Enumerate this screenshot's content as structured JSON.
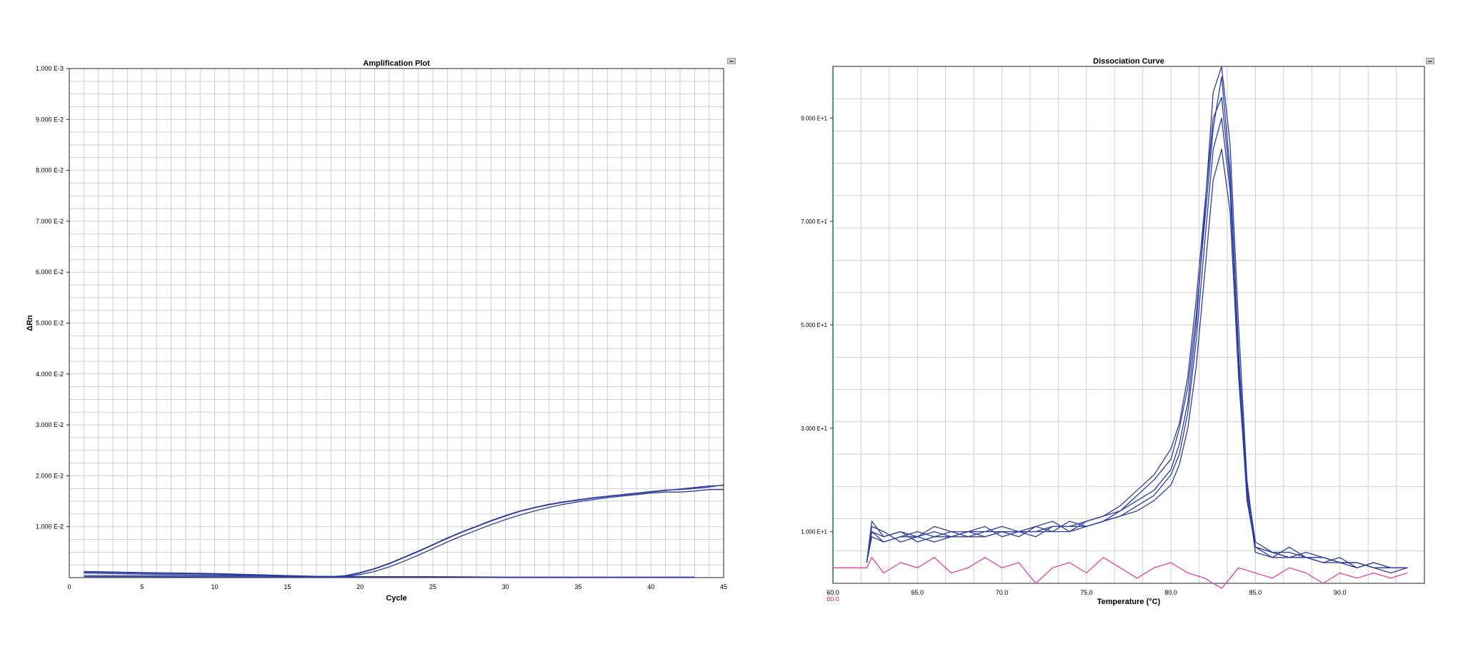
{
  "chart_data": [
    {
      "type": "line",
      "title": "Amplification Plot",
      "xlabel": "Cycle",
      "ylabel": "ΔRn",
      "xlim": [
        0,
        45
      ],
      "ylim": [
        0,
        0.1
      ],
      "x_ticks": [
        0,
        5,
        10,
        15,
        20,
        25,
        30,
        35,
        40,
        45
      ],
      "y_ticks": [
        0.01,
        0.02,
        0.03,
        0.04,
        0.05,
        0.06,
        0.07,
        0.08,
        0.09,
        0.1
      ],
      "y_tick_labels": [
        "1.000 E-2",
        "2.000 E-2",
        "3.000 E-2",
        "4.000 E-2",
        "5.000 E-2",
        "6.000 E-2",
        "7.000 E-2",
        "8.000 E-2",
        "9.000 E-2",
        "1.000 E-3"
      ],
      "grid": true,
      "color": "#2d3d9e",
      "series": [
        {
          "x": [
            1,
            5,
            10,
            15,
            18,
            19,
            20,
            21,
            22,
            23,
            24,
            25,
            26,
            27,
            28,
            29,
            30,
            31,
            32,
            33,
            34,
            35,
            36,
            37,
            38,
            39,
            40,
            41,
            42,
            43,
            44,
            45
          ],
          "values": [
            0.0012,
            0.001,
            0.0008,
            0.0004,
            0.0002,
            0.0004,
            0.001,
            0.0018,
            0.0028,
            0.004,
            0.0052,
            0.0065,
            0.0078,
            0.009,
            0.0101,
            0.0112,
            0.0122,
            0.0131,
            0.0138,
            0.0144,
            0.0149,
            0.0153,
            0.0157,
            0.016,
            0.0163,
            0.0166,
            0.0169,
            0.0172,
            0.0173,
            0.0175,
            0.0178,
            0.0182
          ]
        },
        {
          "x": [
            1,
            5,
            10,
            15,
            18,
            19,
            20,
            21,
            22,
            23,
            24,
            25,
            26,
            27,
            28,
            29,
            30,
            31,
            32,
            33,
            34,
            35,
            36,
            37,
            38,
            39,
            40,
            41,
            42,
            43,
            44,
            45
          ],
          "values": [
            0.0011,
            0.0009,
            0.0007,
            0.0003,
            0.0002,
            0.0003,
            0.0009,
            0.0017,
            0.0027,
            0.0039,
            0.0051,
            0.0064,
            0.0077,
            0.0089,
            0.01,
            0.0111,
            0.0121,
            0.013,
            0.0137,
            0.0143,
            0.0148,
            0.0152,
            0.0156,
            0.0159,
            0.0162,
            0.0165,
            0.0168,
            0.0171,
            0.0174,
            0.0177,
            0.018,
            0.0181
          ]
        },
        {
          "x": [
            1,
            5,
            10,
            15,
            18,
            19,
            20,
            21,
            22,
            23,
            24,
            25,
            26,
            27,
            28,
            29,
            30,
            31,
            32,
            33,
            34,
            35,
            36,
            37,
            38,
            39,
            40,
            41,
            42,
            43,
            44,
            45
          ],
          "values": [
            0.0009,
            0.0007,
            0.0005,
            0.0002,
            0.0001,
            0.0002,
            0.0006,
            0.0012,
            0.0021,
            0.0032,
            0.0044,
            0.0057,
            0.007,
            0.0082,
            0.0093,
            0.0104,
            0.0114,
            0.0123,
            0.0131,
            0.0138,
            0.0144,
            0.0149,
            0.0153,
            0.0157,
            0.016,
            0.0163,
            0.0166,
            0.0168,
            0.0168,
            0.017,
            0.0173,
            0.0173
          ]
        },
        {
          "x": [
            1,
            5,
            10,
            15,
            20,
            25,
            30,
            35,
            40,
            43
          ],
          "values": [
            0.0002,
            0.0002,
            0.0001,
            0.0001,
            0.0001,
            0.0001,
            0.0,
            0.0,
            0.0,
            0.0
          ]
        },
        {
          "x": [
            1,
            5,
            10,
            15,
            20,
            25,
            30,
            35,
            40,
            43
          ],
          "values": [
            0.0004,
            0.0004,
            0.0003,
            0.0003,
            0.0002,
            0.0002,
            0.0001,
            0.0001,
            0.0001,
            0.0001
          ]
        }
      ]
    },
    {
      "type": "line",
      "title": "Dissociation Curve",
      "xlabel": "Temperature (°C)",
      "ylabel": "",
      "xlim": [
        60,
        95
      ],
      "ylim": [
        0,
        1
      ],
      "x_ticks": [
        60,
        65,
        70,
        75,
        80,
        85,
        90
      ],
      "x_tick_labels": [
        "60.0",
        "65.0",
        "70.0",
        "75.0",
        "80.0",
        "85.0",
        "90.0"
      ],
      "x_tick_label_extra": "60.0",
      "x_tick_label_extra_color": "#e8263a",
      "y_ticks": [
        0.1,
        0.3,
        0.5,
        0.7,
        0.9
      ],
      "y_tick_labels": [
        "1.000 E+1",
        "3.000 E+1",
        "5.000 E+1",
        "7.000 E+1",
        "9.000 E+1"
      ],
      "grid": true,
      "series": [
        {
          "color": "#2d3d9e",
          "x": [
            62,
            62.3,
            63,
            64,
            65,
            66,
            67,
            68,
            69,
            70,
            71,
            72,
            73,
            74,
            75,
            76,
            77,
            78,
            79,
            80,
            80.5,
            81,
            81.5,
            82,
            82.5,
            83,
            83.5,
            84,
            84.5,
            85,
            86,
            87,
            88,
            89,
            90,
            91,
            92,
            93,
            94
          ],
          "values": [
            0.04,
            0.12,
            0.09,
            0.1,
            0.09,
            0.1,
            0.09,
            0.1,
            0.09,
            0.1,
            0.1,
            0.1,
            0.11,
            0.11,
            0.12,
            0.13,
            0.14,
            0.16,
            0.18,
            0.22,
            0.27,
            0.35,
            0.5,
            0.72,
            0.95,
            1.0,
            0.85,
            0.5,
            0.2,
            0.07,
            0.06,
            0.06,
            0.05,
            0.05,
            0.04,
            0.04,
            0.03,
            0.03,
            0.03
          ]
        },
        {
          "color": "#2d3d9e",
          "x": [
            62,
            62.3,
            63,
            64,
            65,
            66,
            67,
            68,
            69,
            70,
            71,
            72,
            73,
            74,
            75,
            76,
            77,
            78,
            79,
            80,
            80.5,
            81,
            81.5,
            82,
            82.5,
            83,
            83.5,
            84,
            84.5,
            85,
            86,
            87,
            88,
            89,
            90,
            91,
            92,
            93,
            94
          ],
          "values": [
            0.04,
            0.1,
            0.08,
            0.09,
            0.1,
            0.09,
            0.1,
            0.1,
            0.11,
            0.09,
            0.1,
            0.11,
            0.1,
            0.12,
            0.11,
            0.12,
            0.14,
            0.17,
            0.2,
            0.24,
            0.3,
            0.38,
            0.52,
            0.7,
            0.88,
            0.98,
            0.8,
            0.45,
            0.18,
            0.06,
            0.05,
            0.07,
            0.05,
            0.04,
            0.05,
            0.03,
            0.04,
            0.03,
            0.03
          ]
        },
        {
          "color": "#2d3d9e",
          "x": [
            62,
            62.3,
            63,
            64,
            65,
            66,
            67,
            68,
            69,
            70,
            71,
            72,
            73,
            74,
            75,
            76,
            77,
            78,
            79,
            80,
            80.5,
            81,
            81.5,
            82,
            82.5,
            83,
            83.5,
            84,
            84.5,
            85,
            86,
            87,
            88,
            89,
            90,
            91,
            92,
            93,
            94
          ],
          "values": [
            0.04,
            0.11,
            0.1,
            0.08,
            0.09,
            0.11,
            0.1,
            0.09,
            0.1,
            0.1,
            0.09,
            0.11,
            0.12,
            0.1,
            0.12,
            0.13,
            0.15,
            0.18,
            0.21,
            0.26,
            0.31,
            0.4,
            0.55,
            0.73,
            0.9,
            0.94,
            0.78,
            0.42,
            0.16,
            0.07,
            0.06,
            0.05,
            0.06,
            0.05,
            0.04,
            0.04,
            0.03,
            0.02,
            0.03
          ]
        },
        {
          "color": "#2d3d9e",
          "x": [
            62,
            62.3,
            63,
            64,
            65,
            66,
            67,
            68,
            69,
            70,
            71,
            72,
            73,
            74,
            75,
            76,
            77,
            78,
            79,
            80,
            80.5,
            81,
            81.5,
            82,
            82.5,
            83,
            83.5,
            84,
            84.5,
            85,
            86,
            87,
            88,
            89,
            90,
            91,
            92,
            93,
            94
          ],
          "values": [
            0.04,
            0.1,
            0.09,
            0.1,
            0.08,
            0.09,
            0.09,
            0.1,
            0.1,
            0.11,
            0.1,
            0.09,
            0.11,
            0.11,
            0.11,
            0.12,
            0.13,
            0.15,
            0.17,
            0.21,
            0.25,
            0.33,
            0.47,
            0.66,
            0.84,
            0.9,
            0.76,
            0.44,
            0.19,
            0.08,
            0.06,
            0.05,
            0.05,
            0.05,
            0.04,
            0.03,
            0.04,
            0.03,
            0.03
          ]
        },
        {
          "color": "#2d3d9e",
          "x": [
            62,
            62.3,
            63,
            64,
            65,
            66,
            67,
            68,
            69,
            70,
            71,
            72,
            73,
            74,
            75,
            76,
            77,
            78,
            79,
            80,
            80.5,
            81,
            81.5,
            82,
            82.5,
            83,
            83.5,
            84,
            84.5,
            85,
            86,
            87,
            88,
            89,
            90,
            91,
            92,
            93,
            94
          ],
          "values": [
            0.04,
            0.09,
            0.08,
            0.09,
            0.09,
            0.08,
            0.09,
            0.09,
            0.09,
            0.1,
            0.1,
            0.1,
            0.1,
            0.1,
            0.11,
            0.12,
            0.13,
            0.14,
            0.16,
            0.19,
            0.23,
            0.3,
            0.42,
            0.6,
            0.78,
            0.84,
            0.72,
            0.4,
            0.17,
            0.07,
            0.05,
            0.05,
            0.05,
            0.04,
            0.04,
            0.04,
            0.03,
            0.03,
            0.03
          ]
        },
        {
          "color": "#e040a0",
          "x": [
            60,
            62,
            62.3,
            63,
            64,
            65,
            66,
            67,
            68,
            69,
            70,
            71,
            72,
            73,
            74,
            75,
            76,
            77,
            78,
            79,
            80,
            81,
            82,
            83,
            84,
            85,
            86,
            87,
            88,
            89,
            90,
            91,
            92,
            93,
            94
          ],
          "values": [
            0.03,
            0.03,
            0.05,
            0.02,
            0.04,
            0.03,
            0.05,
            0.02,
            0.03,
            0.05,
            0.03,
            0.04,
            0.0,
            0.03,
            0.04,
            0.02,
            0.05,
            0.03,
            0.01,
            0.03,
            0.04,
            0.02,
            0.01,
            -0.01,
            0.03,
            0.02,
            0.01,
            0.03,
            0.02,
            0.0,
            0.02,
            0.01,
            0.02,
            0.01,
            0.02
          ]
        }
      ]
    }
  ]
}
